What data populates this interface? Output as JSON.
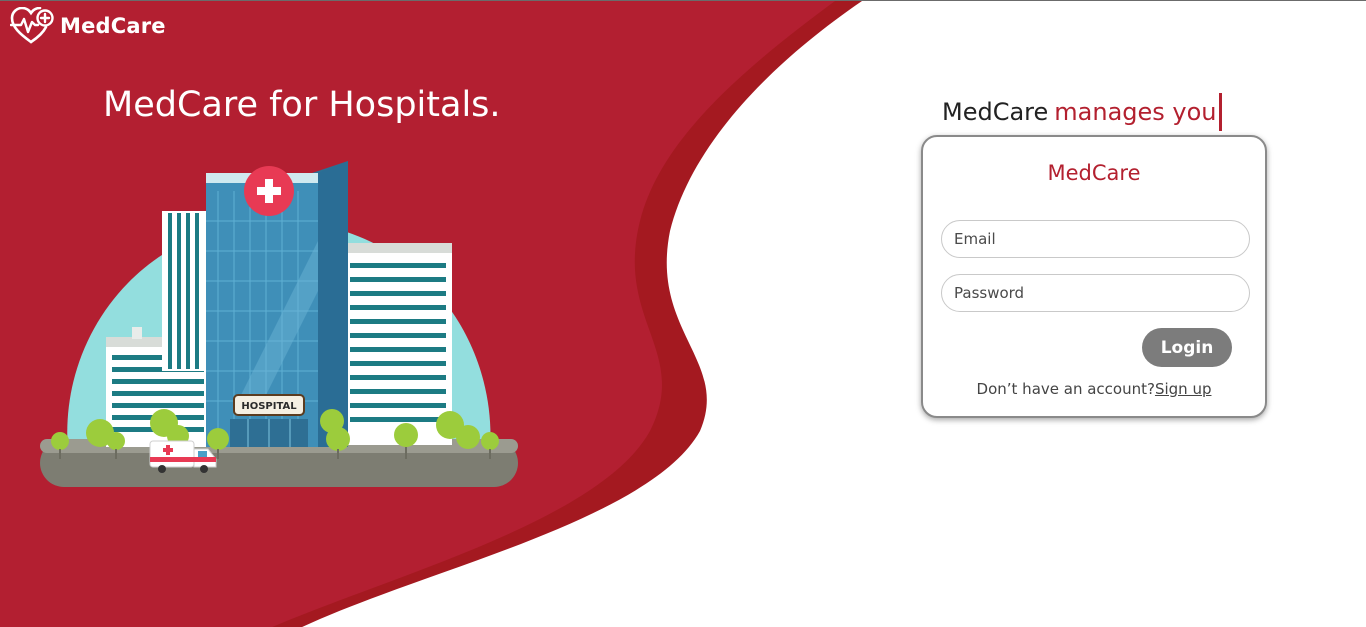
{
  "brand": {
    "name": "MedCare",
    "logo_icon": "heart-pulse-plus-icon"
  },
  "hero": {
    "title": "MedCare for Hospitals.",
    "illustration": "hospital-building-illustration",
    "building_sign": "HOSPITAL"
  },
  "tagline": {
    "prefix": "MedCare",
    "accent": "manages you"
  },
  "login_card": {
    "title": "MedCare",
    "email_placeholder": "Email",
    "password_placeholder": "Password",
    "login_label": "Login",
    "signup_prompt": "Don’t have an account?",
    "signup_link": "Sign up"
  },
  "colors": {
    "brand_red": "#b31f31",
    "brand_red_dark": "#a41920",
    "accent_text": "#b3202f",
    "button_gray": "#7c7c7c"
  }
}
